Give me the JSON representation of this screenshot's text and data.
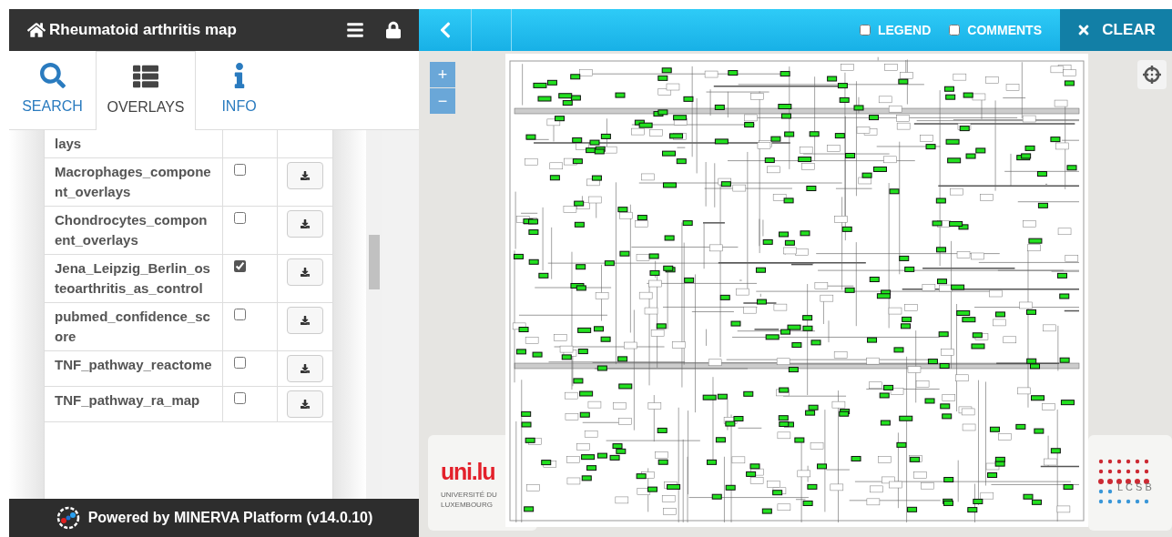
{
  "header": {
    "title": "Rheumatoid arthritis map"
  },
  "tabs": [
    {
      "label": "SEARCH",
      "kind": "search",
      "selected": false
    },
    {
      "label": "OVERLAYS",
      "kind": "overlays",
      "selected": true
    },
    {
      "label": "INFO",
      "kind": "info",
      "selected": false
    }
  ],
  "overlays": [
    {
      "name": "lays"
    },
    {
      "name": "Macrophages_component_overlays",
      "checked": false
    },
    {
      "name": "Chondrocytes_component_overlays",
      "checked": false
    },
    {
      "name": "Jena_Leipzig_Berlin_osteoarthritis_as_control",
      "checked": true
    },
    {
      "name": "pubmed_confidence_score",
      "checked": false
    },
    {
      "name": "TNF_pathway_reactome",
      "checked": false
    },
    {
      "name": "TNF_pathway_ra_map",
      "checked": false
    }
  ],
  "footer": {
    "text": "Powered by MINERVA Platform (v14.0.10)"
  },
  "toolbar": {
    "options": [
      {
        "label": "LEGEND",
        "checked": false
      },
      {
        "label": "COMMENTS",
        "checked": false
      }
    ],
    "clear": "CLEAR"
  },
  "zoom": {
    "in": "+",
    "out": "−"
  },
  "logos": {
    "uni": "uni.lu",
    "uni_line1": "UNIVERSITÉ DU",
    "uni_line2": "LUXEMBOURG",
    "lcsb": "LCSB"
  }
}
